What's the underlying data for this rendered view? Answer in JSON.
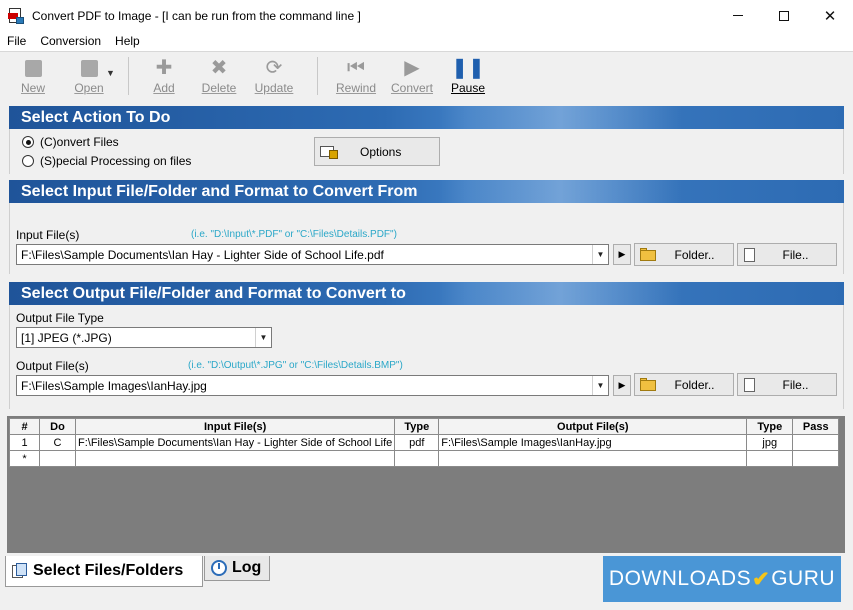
{
  "window": {
    "title": "Convert PDF to Image - [I can be run from the command line ]"
  },
  "menu": [
    "File",
    "Conversion",
    "Help"
  ],
  "toolbar": {
    "new": "New",
    "open": "Open",
    "add": "Add",
    "delete": "Delete",
    "update": "Update",
    "rewind": "Rewind",
    "convert": "Convert",
    "pause": "Pause"
  },
  "action_section": {
    "title": "Select Action To Do",
    "radio_convert": "(C)onvert Files",
    "radio_special": "(S)pecial Processing on files",
    "selected": "convert",
    "options_button": "Options"
  },
  "input_section": {
    "title": "Select Input File/Folder and Format to Convert From",
    "label": "Input File(s)",
    "hint": "(i.e. \"D:\\Input\\*.PDF\"  or  \"C:\\Files\\Details.PDF\")",
    "value": "F:\\Files\\Sample Documents\\Ian Hay - Lighter Side of School Life.pdf",
    "folder_button": "Folder..",
    "file_button": "File.."
  },
  "output_section": {
    "title": "Select Output File/Folder and Format to Convert to",
    "type_label": "Output File Type",
    "type_value": "[1] JPEG (*.JPG)",
    "file_label": "Output File(s)",
    "hint": "(i.e. \"D:\\Output\\*.JPG\"  or  \"C:\\Files\\Details.BMP\")",
    "value": "F:\\Files\\Sample Images\\IanHay.jpg",
    "folder_button": "Folder..",
    "file_button": "File.."
  },
  "grid": {
    "headers": [
      "#",
      "Do",
      "Input File(s)",
      "Type",
      "Output File(s)",
      "Type",
      "Pass"
    ],
    "rows": [
      [
        "1",
        "C",
        "F:\\Files\\Sample Documents\\Ian Hay - Lighter Side of School Life",
        "pdf",
        "F:\\Files\\Sample Images\\IanHay.jpg",
        "jpg",
        ""
      ],
      [
        "*",
        "",
        "",
        "",
        "",
        "",
        ""
      ]
    ]
  },
  "tabs": {
    "files": "Select Files/Folders",
    "log": "Log"
  },
  "watermark": {
    "left": "DOWNLOADS",
    "right": "GURU"
  }
}
